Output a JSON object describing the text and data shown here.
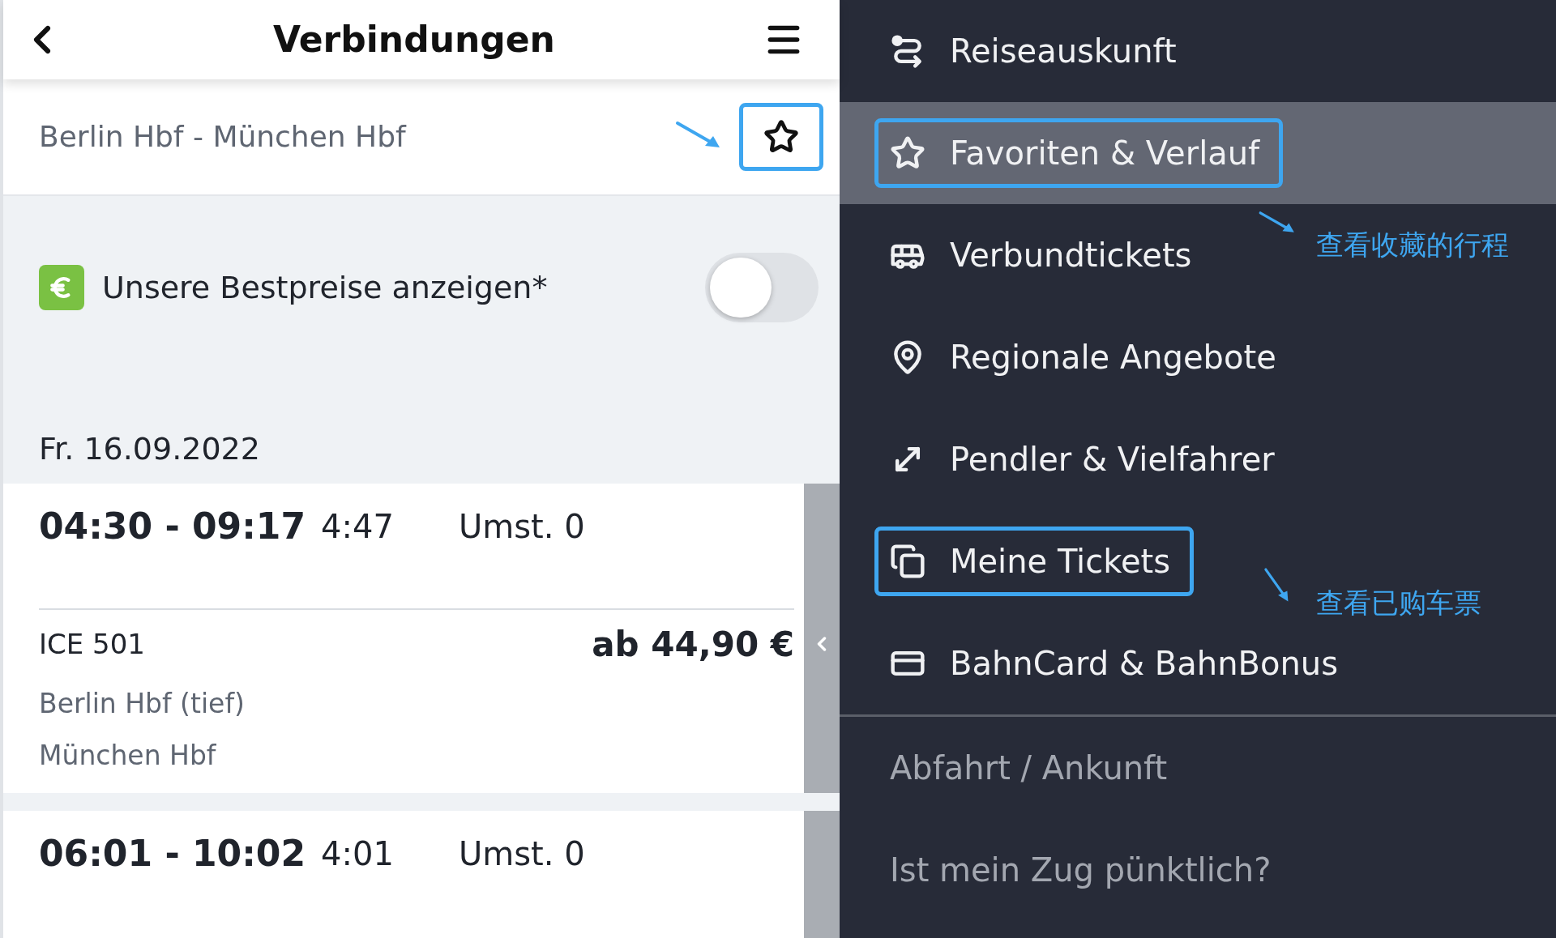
{
  "header": {
    "title": "Verbindungen"
  },
  "route": {
    "label": "Berlin Hbf - München Hbf",
    "annotated": true
  },
  "bestprice": {
    "label": "Unsere Bestpreise anzeigen*",
    "on": false
  },
  "date": "Fr. 16.09.2022",
  "connections": [
    {
      "times": "04:30 - 09:17",
      "duration": "4:47",
      "changes": "Umst. 0",
      "train": "ICE 501",
      "price": "ab 44,90 €",
      "stops": [
        "Berlin Hbf (tief)",
        "München Hbf"
      ]
    },
    {
      "times": "06:01 - 10:02",
      "duration": "4:01",
      "changes": "Umst. 0"
    }
  ],
  "menu": {
    "items": [
      {
        "kind": "main",
        "label": "Reiseauskunft",
        "selected": false,
        "annotated": false
      },
      {
        "kind": "main",
        "label": "Favoriten & Verlauf",
        "selected": true,
        "annotated": true,
        "note": "查看收藏的行程"
      },
      {
        "kind": "main",
        "label": "Verbundtickets",
        "selected": false,
        "annotated": false
      },
      {
        "kind": "main",
        "label": "Regionale Angebote",
        "selected": false,
        "annotated": false
      },
      {
        "kind": "main",
        "label": "Pendler & Vielfahrer",
        "selected": false,
        "annotated": false
      },
      {
        "kind": "main",
        "label": "Meine Tickets",
        "selected": false,
        "annotated": true,
        "note": "查看已购车票"
      },
      {
        "kind": "main",
        "label": "BahnCard & BahnBonus",
        "selected": false,
        "annotated": false
      },
      {
        "kind": "secondary",
        "label": "Abfahrt / Ankunft",
        "selected": false,
        "annotated": false
      },
      {
        "kind": "secondary",
        "label": "Ist mein Zug pünktlich?",
        "selected": false,
        "annotated": false
      }
    ]
  }
}
